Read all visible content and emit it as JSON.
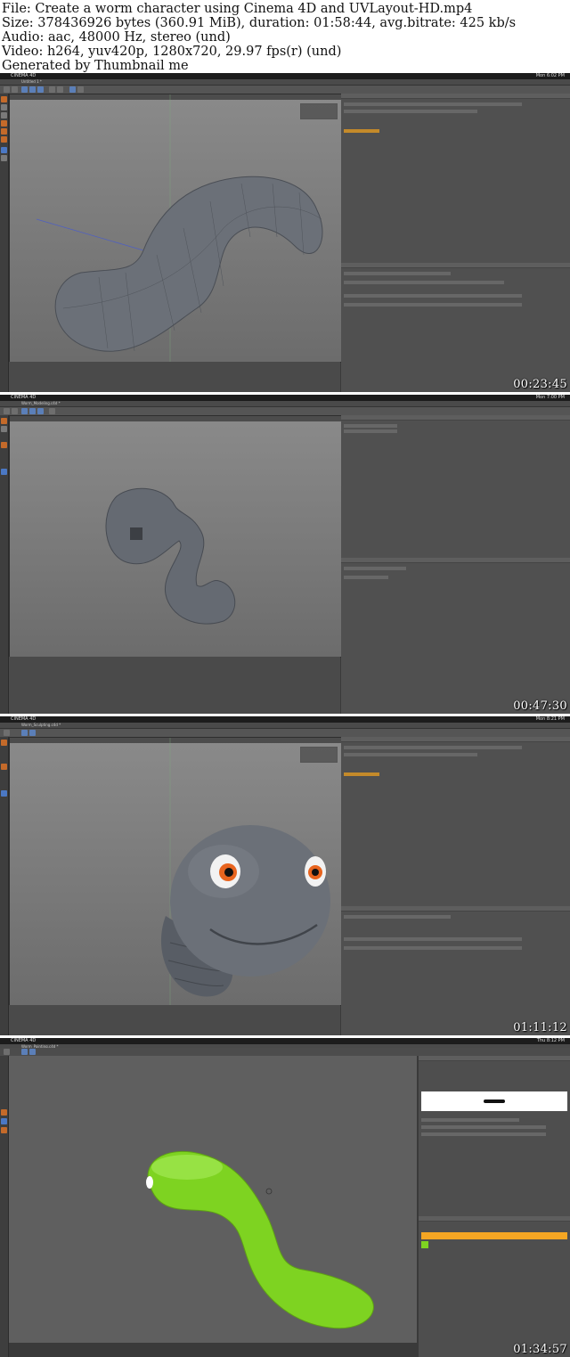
{
  "header": {
    "file": "File: Create a worm character using Cinema 4D and UVLayout-HD.mp4",
    "size": "Size: 378436926 bytes (360.91 MiB), duration: 01:58:44, avg.bitrate: 425 kb/s",
    "audio": "Audio: aac, 48000 Hz, stereo (und)",
    "video": "Video: h264, yuv420p, 1280x720, 29.97 fps(r) (und)",
    "generated": "Generated by Thumbnail me"
  },
  "app": {
    "name": "CINEMA 4D",
    "window_menu": "Window"
  },
  "frames": [
    {
      "timestamp": "00:23:45",
      "doc_title": "Untitled 1 *",
      "clock": "Mon 6:02 PM"
    },
    {
      "timestamp": "00:47:30",
      "doc_title": "Worm_Modeling.c4d *",
      "clock": "Mon 7:00 PM"
    },
    {
      "timestamp": "01:11:12",
      "doc_title": "Worm_Sculpting.c4d *",
      "clock": "Mon 8:21 PM"
    },
    {
      "timestamp": "01:34:57",
      "doc_title": "Worm_Painting.c4d *",
      "clock": "Thu 8:12 PM"
    }
  ],
  "colors": {
    "worm_gray": "#6b7078",
    "worm_green": "#7ed321",
    "accent_orange": "#f5a623",
    "panel": "#505050"
  }
}
